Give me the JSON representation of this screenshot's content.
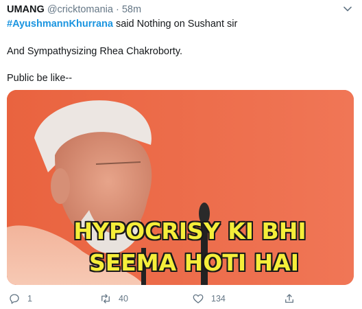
{
  "tweet": {
    "author": "UMANG",
    "handle": "@cricktomania",
    "separator": "·",
    "time": "58m",
    "hashtag": "#AyushmannKhurrana",
    "line1_rest": " said Nothing on Sushant sir",
    "line2": "And Sympathysizing Rhea Chakroborty.",
    "line3": "Public be like--"
  },
  "media": {
    "caption_line1": "HYPOCRISY KI BHI",
    "caption_line2": "SEEMA HOTI HAI",
    "background_color": "#ee6a4a",
    "caption_color": "#f5ee3a"
  },
  "actions": {
    "reply_count": "1",
    "retweet_count": "40",
    "like_count": "134"
  },
  "icons": {
    "caret": "chevron-down-icon",
    "reply": "reply-icon",
    "retweet": "retweet-icon",
    "like": "heart-icon",
    "share": "share-icon"
  },
  "colors": {
    "link": "#1b95e0",
    "muted": "#657786",
    "text": "#14171a"
  }
}
